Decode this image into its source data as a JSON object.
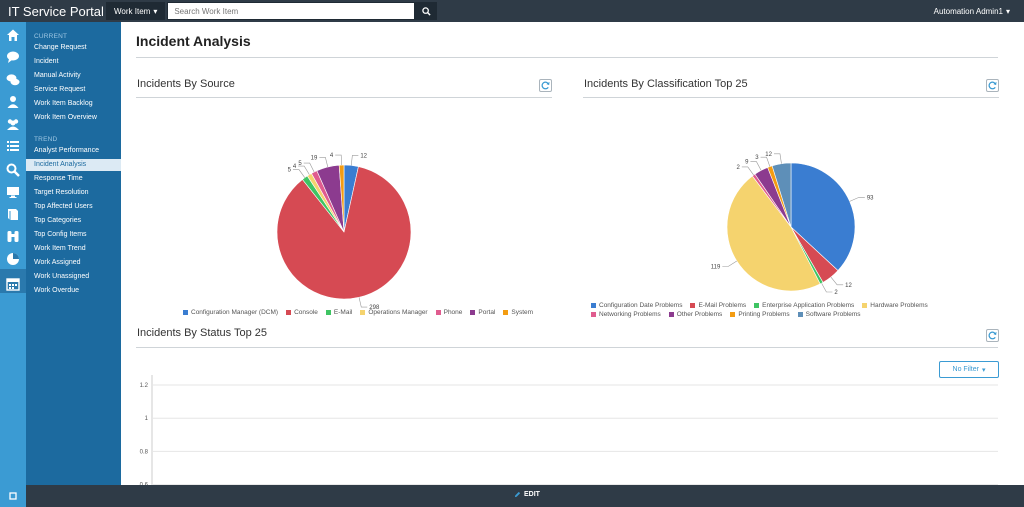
{
  "header": {
    "brand": "IT Service Portal",
    "work_item_label": "Work Item",
    "search_placeholder": "Search Work Item",
    "user": "Automation Admin1"
  },
  "nav": {
    "current_heading": "CURRENT",
    "current_items": [
      "Change Request",
      "Incident",
      "Manual Activity",
      "Service Request",
      "Work Item Backlog",
      "Work Item Overview"
    ],
    "trend_heading": "TREND",
    "trend_items": [
      "Analyst Performance",
      "Incident Analysis",
      "Response Time",
      "Target Resolution",
      "Top Affected Users",
      "Top Categories",
      "Top Config Items",
      "Work Item Trend",
      "Work Assigned",
      "Work Unassigned",
      "Work Overdue"
    ],
    "active_item": "Incident Analysis"
  },
  "page": {
    "title": "Incident Analysis"
  },
  "panels": {
    "by_source_title": "Incidents By Source",
    "by_classification_title": "Incidents By Classification Top 25",
    "by_status_title": "Incidents By Status Top 25",
    "filter_label": "No Filter"
  },
  "footer": {
    "edit_label": "EDIT"
  },
  "chart_data": [
    {
      "type": "pie",
      "categories": [
        "Configuration Manager (DCM)",
        "Console",
        "E-Mail",
        "Operations Manager",
        "Phone",
        "Portal",
        "System"
      ],
      "values": [
        12,
        298,
        5,
        4,
        5,
        19,
        4
      ],
      "colors": [
        "#3a7dd1",
        "#d64a53",
        "#3fc463",
        "#f5d36e",
        "#e05c8f",
        "#8c3b8f",
        "#f39c12"
      ],
      "legend": "bottom"
    },
    {
      "type": "pie",
      "categories": [
        "Configuration Date Problems",
        "E-Mail Problems",
        "Enterprise Application Problems",
        "Hardware Problems",
        "Networking Problems",
        "Other Problems",
        "Printing Problems",
        "Software Problems"
      ],
      "values": [
        93,
        12,
        2,
        119,
        2,
        9,
        3,
        12
      ],
      "colors": [
        "#3a7dd1",
        "#d64a53",
        "#3fc463",
        "#f5d36e",
        "#e05c8f",
        "#8c3b8f",
        "#f39c12",
        "#5e8fb8"
      ],
      "legend": "bottom"
    },
    {
      "type": "bar",
      "categories": [],
      "series": [],
      "yticks": [
        0.6,
        0.8,
        1,
        1.2
      ],
      "ylim": [
        0,
        1.2
      ],
      "grid": true
    }
  ]
}
